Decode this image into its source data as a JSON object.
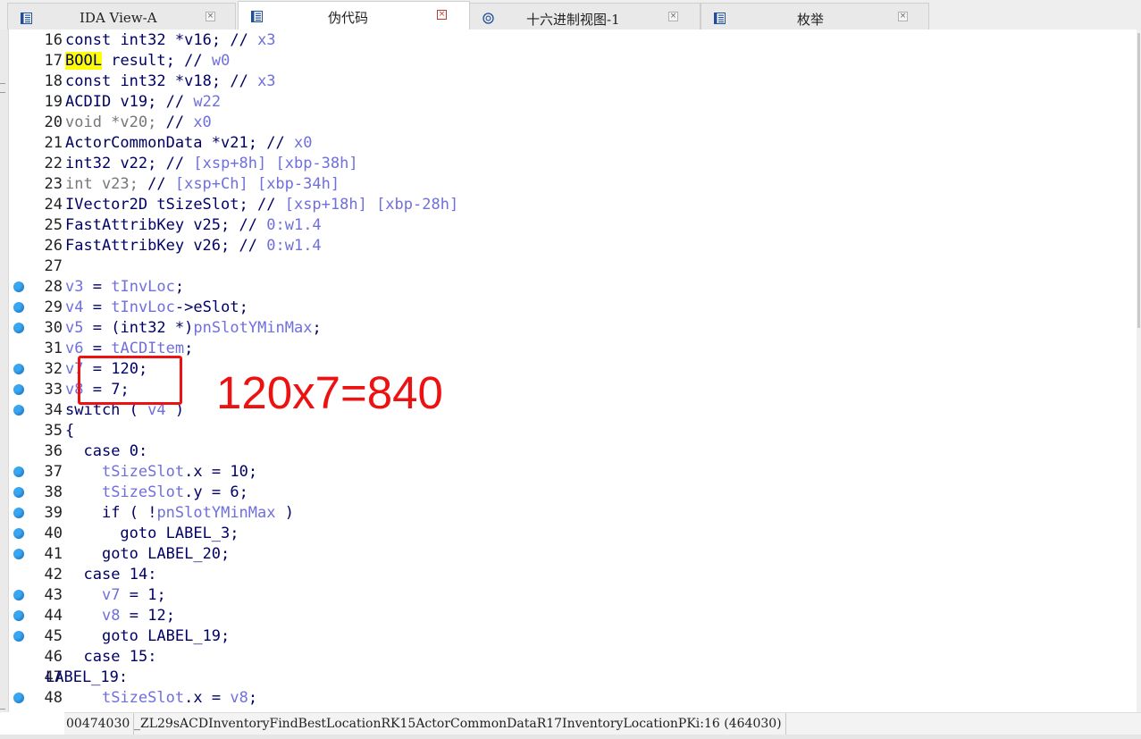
{
  "tabs": [
    {
      "label": "IDA View-A",
      "icon": "disassembly-view-icon",
      "active": false
    },
    {
      "label": "伪代码",
      "icon": "pseudocode-view-icon",
      "active": true
    },
    {
      "label": "十六进制视图-1",
      "icon": "hex-view-icon",
      "active": false
    },
    {
      "label": "枚举",
      "icon": "enum-view-icon",
      "active": false
    }
  ],
  "close_glyph": "×",
  "colors": {
    "identifier": "#000066",
    "variable": "#6f6fdd",
    "comment": "#6f6fdd",
    "highlight": "#ffff00",
    "breakpoint": "#39a6f0",
    "annotation": "#ee1111"
  },
  "code_lines": [
    {
      "no": "16",
      "bp": false,
      "text": "const int32 *v16; // x3"
    },
    {
      "no": "17",
      "bp": false,
      "text": "BOOL result; // w0"
    },
    {
      "no": "18",
      "bp": false,
      "text": "const int32 *v18; // x3"
    },
    {
      "no": "19",
      "bp": false,
      "text": "ACDID v19; // w22"
    },
    {
      "no": "20",
      "bp": false,
      "text": "void *v20; // x0"
    },
    {
      "no": "21",
      "bp": false,
      "text": "ActorCommonData *v21; // x0"
    },
    {
      "no": "22",
      "bp": false,
      "text": "int32 v22; // [xsp+8h] [xbp-38h]"
    },
    {
      "no": "23",
      "bp": false,
      "text": "int v23; // [xsp+Ch] [xbp-34h]"
    },
    {
      "no": "24",
      "bp": false,
      "text": "IVector2D tSizeSlot; // [xsp+18h] [xbp-28h]"
    },
    {
      "no": "25",
      "bp": false,
      "text": "FastAttribKey v25; // 0:w1.4"
    },
    {
      "no": "26",
      "bp": false,
      "text": "FastAttribKey v26; // 0:w1.4"
    },
    {
      "no": "27",
      "bp": false,
      "text": ""
    },
    {
      "no": "28",
      "bp": true,
      "text": "v3 = tInvLoc;"
    },
    {
      "no": "29",
      "bp": true,
      "text": "v4 = tInvLoc->eSlot;"
    },
    {
      "no": "30",
      "bp": true,
      "text": "v5 = (int32 *)pnSlotYMinMax;"
    },
    {
      "no": "31",
      "bp": false,
      "text": "v6 = tACDItem;"
    },
    {
      "no": "32",
      "bp": true,
      "text": "v7 = 120;"
    },
    {
      "no": "33",
      "bp": true,
      "text": "v8 = 7;"
    },
    {
      "no": "34",
      "bp": true,
      "text": "switch ( v4 )"
    },
    {
      "no": "35",
      "bp": false,
      "text": "{"
    },
    {
      "no": "36",
      "bp": false,
      "text": "  case 0:"
    },
    {
      "no": "37",
      "bp": true,
      "text": "    tSizeSlot.x = 10;"
    },
    {
      "no": "38",
      "bp": true,
      "text": "    tSizeSlot.y = 6;"
    },
    {
      "no": "39",
      "bp": true,
      "text": "    if ( !pnSlotYMinMax )"
    },
    {
      "no": "40",
      "bp": true,
      "text": "      goto LABEL_3;"
    },
    {
      "no": "41",
      "bp": true,
      "text": "    goto LABEL_20;"
    },
    {
      "no": "42",
      "bp": false,
      "text": "  case 14:"
    },
    {
      "no": "43",
      "bp": true,
      "text": "    v7 = 1;"
    },
    {
      "no": "44",
      "bp": true,
      "text": "    v8 = 12;"
    },
    {
      "no": "45",
      "bp": true,
      "text": "    goto LABEL_19;"
    },
    {
      "no": "46",
      "bp": false,
      "text": "  case 15:"
    },
    {
      "no": "47",
      "bp": false,
      "text": "LABEL_19:"
    },
    {
      "no": "48",
      "bp": true,
      "text": "    tSizeSlot.x = v8;"
    }
  ],
  "annotation": "120x7=840",
  "status": {
    "address": "00474030",
    "location": "_ZL29sACDInventoryFindBestLocationRK15ActorCommonDataR17InventoryLocationPKi:16 (464030)"
  }
}
